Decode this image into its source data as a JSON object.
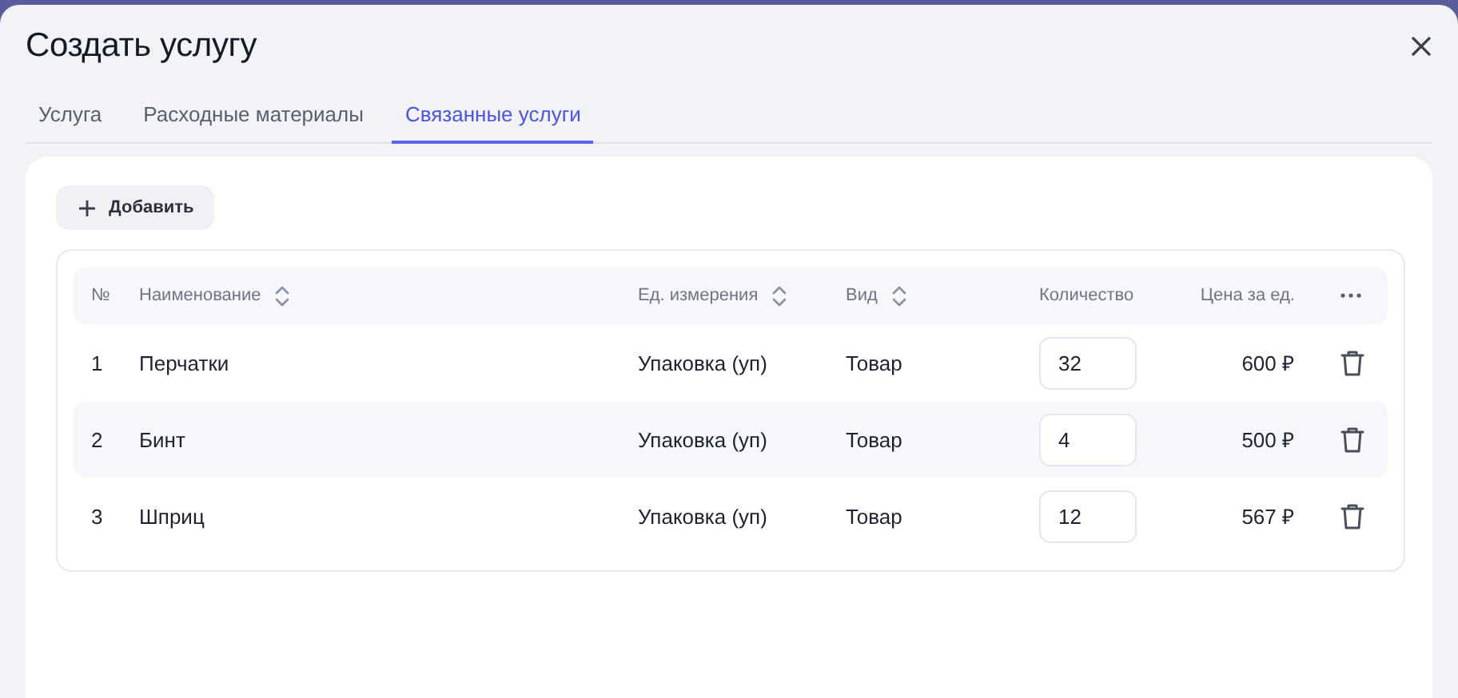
{
  "dialog": {
    "title": "Создать услугу"
  },
  "tabs": [
    {
      "label": "Услуга",
      "selected": false
    },
    {
      "label": "Расходные материалы",
      "selected": false
    },
    {
      "label": "Связанные услуги",
      "selected": true
    }
  ],
  "add_button": {
    "label": "Добавить"
  },
  "table": {
    "columns": [
      {
        "label": "№",
        "sortable": false
      },
      {
        "label": "Наименование",
        "sortable": true
      },
      {
        "label": "Ед. измерения",
        "sortable": true
      },
      {
        "label": "Вид",
        "sortable": true
      },
      {
        "label": "Количество",
        "sortable": false
      },
      {
        "label": "Цена за ед.",
        "sortable": false
      }
    ],
    "rows": [
      {
        "number": "1",
        "name": "Перчатки",
        "unit": "Упаковка (уп)",
        "type": "Товар",
        "quantity": "32",
        "price": "600 ₽"
      },
      {
        "number": "2",
        "name": "Бинт",
        "unit": "Упаковка (уп)",
        "type": "Товар",
        "quantity": "4",
        "price": "500 ₽"
      },
      {
        "number": "3",
        "name": "Шприц",
        "unit": "Упаковка (уп)",
        "type": "Товар",
        "quantity": "12",
        "price": "567 ₽"
      }
    ]
  }
}
